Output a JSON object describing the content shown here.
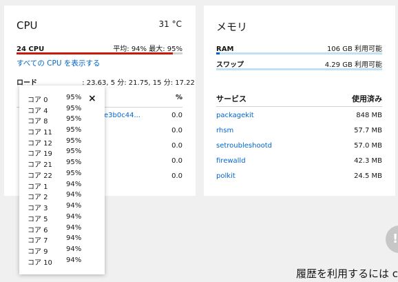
{
  "cpu": {
    "title": "CPU",
    "temperature": "31 °C",
    "usage_label": "24 CPU",
    "usage_stats": "平均: 94% 最大: 95%",
    "usage_fraction": 0.94,
    "show_all_link": "すべての CPU を表示する",
    "load_label": "ロード",
    "load_values": ": 23.63, 5 分: 21.75, 15 分: 17.22",
    "col_percent": "%",
    "processes": [
      {
        "name": "",
        "value": "0.0"
      },
      {
        "name": "e3b0c44...",
        "value": "0.0"
      },
      {
        "name": "",
        "value": "0.0"
      },
      {
        "name": "",
        "value": "0.0"
      },
      {
        "name": "",
        "value": "0.0"
      }
    ]
  },
  "popover": {
    "close_label": "×",
    "cores": [
      {
        "name": "コア 0",
        "value": "95%"
      },
      {
        "name": "コア 4",
        "value": "95%"
      },
      {
        "name": "コア 8",
        "value": "95%"
      },
      {
        "name": "コア 11",
        "value": "95%"
      },
      {
        "name": "コア 12",
        "value": "95%"
      },
      {
        "name": "コア 19",
        "value": "95%"
      },
      {
        "name": "コア 21",
        "value": "95%"
      },
      {
        "name": "コア 22",
        "value": "95%"
      },
      {
        "name": "コア 1",
        "value": "94%"
      },
      {
        "name": "コア 2",
        "value": "94%"
      },
      {
        "name": "コア 3",
        "value": "94%"
      },
      {
        "name": "コア 5",
        "value": "94%"
      },
      {
        "name": "コア 6",
        "value": "94%"
      },
      {
        "name": "コア 7",
        "value": "94%"
      },
      {
        "name": "コア 9",
        "value": "94%"
      },
      {
        "name": "コア 10",
        "value": "94%"
      }
    ]
  },
  "memory": {
    "title": "メモリ",
    "ram_label": "RAM",
    "ram_value": "106 GB 利用可能",
    "ram_used_fraction": 0.02,
    "swap_label": "スワップ",
    "swap_value": "4.29 GB 利用可能",
    "swap_used_fraction": 0.0,
    "col_service": "サービス",
    "col_used": "使用済み",
    "services": [
      {
        "name": "packagekit",
        "value": "848 MB"
      },
      {
        "name": "rhsm",
        "value": "57.7 MB"
      },
      {
        "name": "setroubleshootd",
        "value": "57.0 MB"
      },
      {
        "name": "firewalld",
        "value": "42.3 MB"
      },
      {
        "name": "polkit",
        "value": "24.5 MB"
      }
    ]
  },
  "footer": {
    "history_text": "履歴を利用するには co"
  },
  "colors": {
    "cpu_bar": "#c9190b",
    "mem_bar": "#0066cc",
    "link": "#0066cc"
  }
}
